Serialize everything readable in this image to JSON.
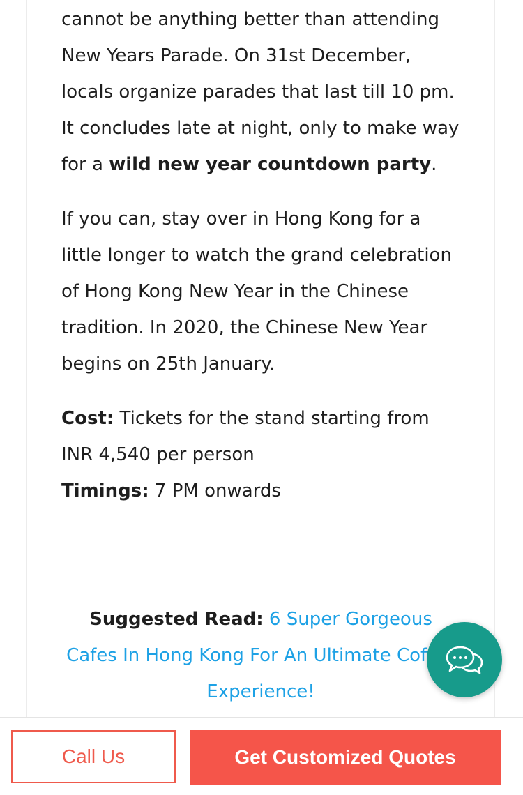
{
  "article": {
    "p1": {
      "text": "cannot be anything better than attending New Years Parade. On 31st December, locals organize parades that last till 10 pm. It concludes late at night, only to make way for a ",
      "bold": "wild new year countdown party",
      "tail": "."
    },
    "p2": "If you can, stay over in Hong Kong for a little longer to watch the grand celebration of Hong Kong New Year in the Chinese tradition. In 2020, the Chinese New Year begins on 25th January.",
    "cost_label": "Cost:",
    "cost_value": " Tickets for the stand starting from INR 4,540 per person",
    "timings_label": "Timings:",
    "timings_value": " 7 PM onwards"
  },
  "suggested": {
    "label": "Suggested Read:",
    "link_text": " 6 Super Gorgeous Cafes In Hong Kong For An Ultimate Coffee Experience!"
  },
  "chat": {
    "icon": "chat-bubbles-icon",
    "color": "#179b8b"
  },
  "bottom_bar": {
    "call_label": "Call Us",
    "quote_label": "Get Customized Quotes",
    "accent": "#f5554a"
  }
}
